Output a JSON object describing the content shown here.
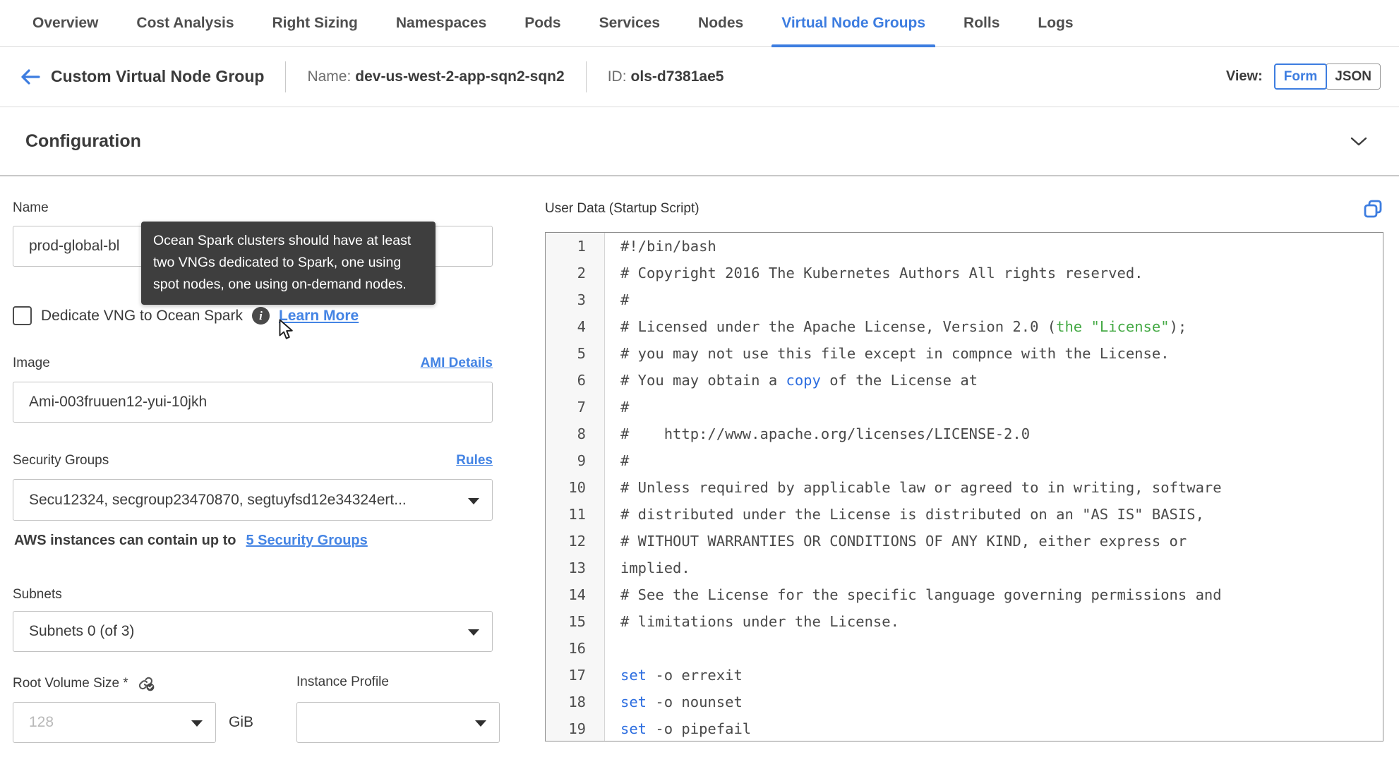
{
  "tabs": {
    "items": [
      {
        "label": "Overview",
        "active": false
      },
      {
        "label": "Cost Analysis",
        "active": false
      },
      {
        "label": "Right Sizing",
        "active": false
      },
      {
        "label": "Namespaces",
        "active": false
      },
      {
        "label": "Pods",
        "active": false
      },
      {
        "label": "Services",
        "active": false
      },
      {
        "label": "Nodes",
        "active": false
      },
      {
        "label": "Virtual Node Groups",
        "active": true
      },
      {
        "label": "Rolls",
        "active": false
      },
      {
        "label": "Logs",
        "active": false
      }
    ]
  },
  "header": {
    "title": "Custom Virtual Node Group",
    "name_label": "Name:",
    "name_value": "dev-us-west-2-app-sqn2-sqn2",
    "id_label": "ID:",
    "id_value": "ols-d7381ae5",
    "view_label": "View:",
    "view_form": "Form",
    "view_json": "JSON",
    "view_selected": "Form"
  },
  "section": {
    "title": "Configuration"
  },
  "form": {
    "name": {
      "label": "Name",
      "value": "prod-global-bl"
    },
    "tooltip": {
      "text": "Ocean Spark clusters should have at least two VNGs dedicated to Spark, one using spot nodes, one using on-demand nodes."
    },
    "dedicate": {
      "label": "Dedicate VNG to Ocean Spark",
      "checked": false,
      "learn_more": "Learn More"
    },
    "image": {
      "label": "Image",
      "link": "AMI Details",
      "value": "Ami-003fruuen12-yui-10jkh"
    },
    "security_groups": {
      "label": "Security Groups",
      "link": "Rules",
      "value": "Secu12324, secgroup23470870, segtuyfsd12e34324ert...",
      "helper_text": "AWS instances can contain up to",
      "helper_link": "5 Security Groups"
    },
    "subnets": {
      "label": "Subnets",
      "value": "Subnets 0 (of 3)"
    },
    "root_volume": {
      "label": "Root Volume Size *",
      "placeholder": "128",
      "unit": "GiB"
    },
    "instance_profile": {
      "label": "Instance Profile",
      "value": ""
    }
  },
  "user_data": {
    "label": "User Data (Startup Script)",
    "lines": [
      {
        "n": 1,
        "segs": [
          {
            "t": "#!/bin/bash"
          }
        ]
      },
      {
        "n": 2,
        "segs": [
          {
            "t": "# Copyright 2016 The Kubernetes Authors All rights reserved."
          }
        ]
      },
      {
        "n": 3,
        "segs": [
          {
            "t": "#"
          }
        ]
      },
      {
        "n": 4,
        "segs": [
          {
            "t": "# Licensed under the Apache License, Version 2.0 ("
          },
          {
            "t": "the \"License\"",
            "c": "green"
          },
          {
            "t": ");"
          }
        ]
      },
      {
        "n": 5,
        "segs": [
          {
            "t": "# you may not use this file except in compnce with the License."
          }
        ]
      },
      {
        "n": 6,
        "segs": [
          {
            "t": "# You may obtain a "
          },
          {
            "t": "copy",
            "c": "blue"
          },
          {
            "t": " of the License at"
          }
        ]
      },
      {
        "n": 7,
        "segs": [
          {
            "t": "#"
          }
        ]
      },
      {
        "n": 8,
        "segs": [
          {
            "t": "#    http://www.apache.org/licenses/LICENSE-2.0"
          }
        ]
      },
      {
        "n": 9,
        "segs": [
          {
            "t": "#"
          }
        ]
      },
      {
        "n": 10,
        "segs": [
          {
            "t": "# Unless required by applicable law or agreed to in writing, software"
          }
        ]
      },
      {
        "n": 11,
        "segs": [
          {
            "t": "# distributed under the License is distributed on an \"AS IS\" BASIS,"
          }
        ]
      },
      {
        "n": 12,
        "segs": [
          {
            "t": "# WITHOUT WARRANTIES OR CONDITIONS OF ANY KIND, either express or"
          }
        ]
      },
      {
        "n": 13,
        "segs": [
          {
            "t": "implied."
          }
        ]
      },
      {
        "n": 14,
        "segs": [
          {
            "t": "# See the License for the specific language governing permissions and"
          }
        ]
      },
      {
        "n": 15,
        "segs": [
          {
            "t": "# limitations under the License."
          }
        ]
      },
      {
        "n": 16,
        "segs": [
          {
            "t": ""
          }
        ]
      },
      {
        "n": 17,
        "segs": [
          {
            "t": "set",
            "c": "blue"
          },
          {
            "t": " -o errexit"
          }
        ]
      },
      {
        "n": 18,
        "segs": [
          {
            "t": "set",
            "c": "blue"
          },
          {
            "t": " -o nounset"
          }
        ]
      },
      {
        "n": 19,
        "segs": [
          {
            "t": "set",
            "c": "blue"
          },
          {
            "t": " -o pipefail"
          }
        ]
      }
    ]
  },
  "icons": {
    "info_glyph": "i"
  },
  "colors": {
    "accent_blue": "#3d7de0",
    "link_blue": "#4484e4",
    "code_green": "#44a944",
    "code_blue": "#2d6ee0",
    "tooltip_bg": "#3e3e3e"
  }
}
